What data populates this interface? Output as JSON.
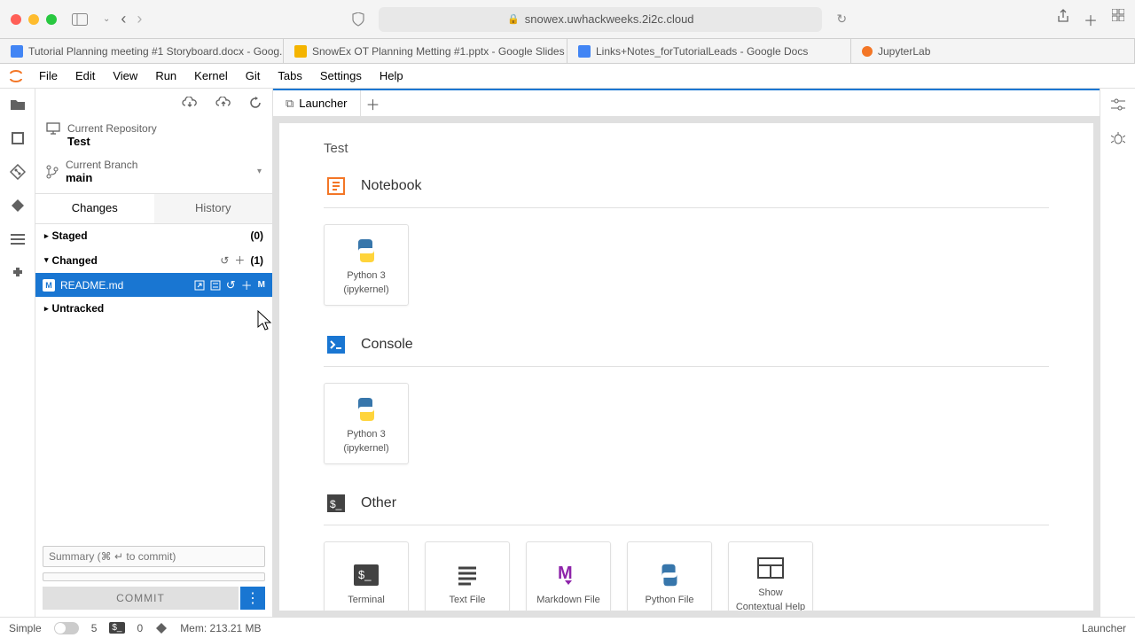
{
  "browser": {
    "url": "snowex.uwhackweeks.2i2c.cloud",
    "tabs": [
      {
        "label": "Tutorial Planning meeting #1 Storyboard.docx - Goog...",
        "iconClass": "docs-icon"
      },
      {
        "label": "SnowEx OT Planning Metting #1.pptx - Google Slides",
        "iconClass": "slides-icon"
      },
      {
        "label": "Links+Notes_forTutorialLeads - Google Docs",
        "iconClass": "docs-icon"
      },
      {
        "label": "JupyterLab",
        "iconClass": "jupyter-icon"
      }
    ]
  },
  "menus": [
    "File",
    "Edit",
    "View",
    "Run",
    "Kernel",
    "Git",
    "Tabs",
    "Settings",
    "Help"
  ],
  "git": {
    "repo_label": "Current Repository",
    "repo_name": "Test",
    "branch_label": "Current Branch",
    "branch_name": "main",
    "tab_changes": "Changes",
    "tab_history": "History",
    "staged_label": "Staged",
    "staged_count": "(0)",
    "changed_label": "Changed",
    "changed_count": "(1)",
    "changed_file": "README.md",
    "changed_badge": "M",
    "untracked_label": "Untracked",
    "summary_placeholder": "Summary (⌘ ↵ to commit)",
    "commit_btn": "COMMIT"
  },
  "launcher": {
    "tab_label": "Launcher",
    "heading": "Test",
    "cat_notebook": "Notebook",
    "cat_console": "Console",
    "cat_other": "Other",
    "kernel_py_line1": "Python 3",
    "kernel_py_line2": "(ipykernel)",
    "other": {
      "terminal": "Terminal",
      "text": "Text File",
      "markdown": "Markdown File",
      "python": "Python File",
      "help1": "Show",
      "help2": "Contextual Help"
    }
  },
  "status": {
    "simple": "Simple",
    "num1": "5",
    "num2": "0",
    "mem": "Mem: 213.21 MB",
    "right": "Launcher"
  }
}
